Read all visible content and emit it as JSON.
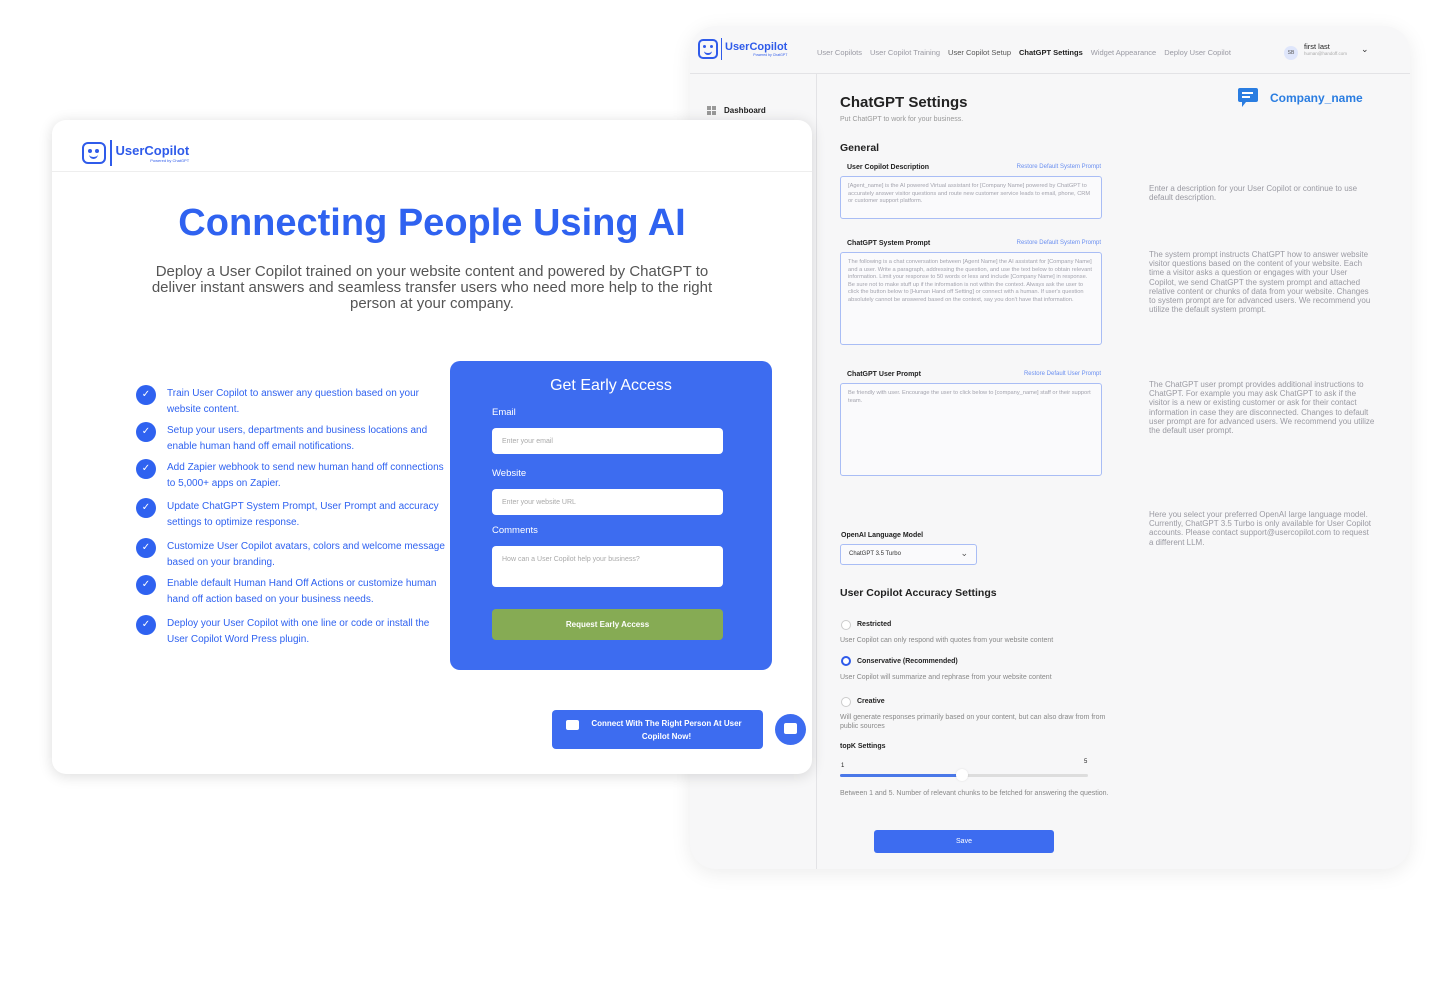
{
  "settings": {
    "logo": {
      "name": "UserCopilot",
      "tagline": "Powered by ChatGPT"
    },
    "nav": [
      {
        "label": "User Copilots",
        "state": "inactive"
      },
      {
        "label": "User Copilot Training",
        "state": "inactive"
      },
      {
        "label": "User Copilot Setup",
        "state": "dark"
      },
      {
        "label": "ChatGPT Settings",
        "state": "active"
      },
      {
        "label": "Widget Appearance",
        "state": "inactive"
      },
      {
        "label": "Deploy User Copilot",
        "state": "inactive"
      }
    ],
    "user": {
      "initials": "SB",
      "name": "first last",
      "email": "human@handoff.com"
    },
    "sidebar": {
      "dashboard_label": "Dashboard"
    },
    "page_title": "ChatGPT Settings",
    "page_subtitle": "Put ChatGPT to work for your business.",
    "company_name": "Company_name",
    "general_heading": "General",
    "description": {
      "label": "User Copilot Description",
      "restore": "Restore Default System Prompt",
      "value": "[Agent_name] is the AI powered Virtual assistant for [Company Name] powered by ChatGPT to accurately answer visitor questions and route new customer service leads to email, phone, CRM or customer support platform.",
      "help": "Enter a description for your User Copilot or continue to use default description."
    },
    "system_prompt": {
      "label": "ChatGPT System Prompt",
      "restore": "Restore Default System Prompt",
      "value": "The following is a chat conversation between [Agent Name] the AI assistant for [Company Name] and a user. Write a paragraph, addressing the question, and use the text below to obtain relevant information. Limit your response to 50 words or less and include [Company Name] in response. Be sure not to make stuff up if the information is not within the context. Always ask the user to click the button below to [Human Hand off Setting] or connect with a human. If user's question absolutely cannot be answered based on the context, say you don't have that information.",
      "help": "The system prompt instructs ChatGPT how to answer website visitor questions based on the content of your website. Each time a visitor asks a question or engages with your User Copilot, we send ChatGPT the system prompt and attached relative content or chunks of data from your website. Changes to system prompt are for advanced users. We recommend you utilize the default system prompt."
    },
    "user_prompt": {
      "label": "ChatGPT User Prompt",
      "restore": "Restore Default User Prompt",
      "value": "Be friendly with user. Encourage the user to click below to [company_name] staff or their support team.",
      "help": "The ChatGPT user prompt provides additional instructions to ChatGPT. For example you may ask ChatGPT to ask if the visitor is a new or existing customer or ask for their contact information in case they are disconnected. Changes to default user prompt are for advanced users. We recommend you utilize the default user prompt."
    },
    "model": {
      "label": "OpenAI Language Model",
      "selected": "ChatGPT 3.5 Turbo",
      "help": "Here you select your preferred OpenAI large language model. Currently, ChatGPT 3.5 Turbo is only available for User Copilot accounts. Please contact support@usercopilot.com to request a different LLM."
    },
    "accuracy_heading": "User Copilot Accuracy Settings",
    "accuracy_options": [
      {
        "label": "Restricted",
        "desc": "User Copilot can only respond with quotes from your website content",
        "selected": false
      },
      {
        "label": "Conservative (Recommended)",
        "desc": "User Copilot will summarize and rephrase from your website content",
        "selected": true
      },
      {
        "label": "Creative",
        "desc": "Will generate responses primarily based on your content, but can also draw from from public sources",
        "selected": false
      }
    ],
    "topk": {
      "label": "topK Settings",
      "min_label": "1",
      "max_label": "5",
      "value_fraction": 0.48,
      "help": "Between 1 and 5. Number of relevant chunks to be fetched for answering the question."
    },
    "save_label": "Save"
  },
  "landing": {
    "logo": {
      "name": "UserCopilot",
      "tagline": "Powered by ChatGPT"
    },
    "title": "Connecting People Using AI",
    "lead": "Deploy a User Copilot trained on your website content and powered by ChatGPT to deliver instant answers and seamless transfer users who need more help to the right person at your company.",
    "features": [
      "Train User Copilot to answer any question based on your website content.",
      "Setup your users, departments and business locations and enable human hand off email notifications.",
      "Add Zapier webhook to send new human hand off connections to 5,000+ apps on Zapier.",
      "Update ChatGPT System Prompt, User Prompt and accuracy settings to optimize response.",
      "Customize User Copilot avatars, colors and welcome message based on your branding.",
      "Enable default Human Hand Off Actions or customize human hand off action based on your business needs.",
      "Deploy your User Copilot with one line or code or install the User Copilot Word Press plugin."
    ],
    "form": {
      "title": "Get Early Access",
      "email_label": "Email",
      "email_placeholder": "Enter your email",
      "website_label": "Website",
      "website_placeholder": "Enter your website URL",
      "comments_label": "Comments",
      "comments_placeholder": "How can a User Copilot help your business?",
      "submit_label": "Request Early Access"
    },
    "connect_label": "Connect With The Right Person At User Copilot Now!"
  }
}
